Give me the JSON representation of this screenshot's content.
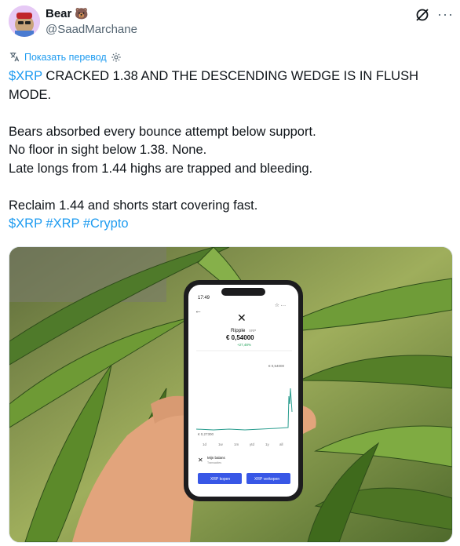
{
  "author": {
    "name": "Bear",
    "emoji": "🐻",
    "handle": "@SaadMarchane"
  },
  "translate": {
    "label": "Показать перевод"
  },
  "tweet": {
    "cashtag1": "$XRP",
    "line1": " CRACKED 1.38 AND THE DESCENDING WEDGE IS IN FLUSH MODE.",
    "body": "Bears absorbed every bounce attempt below support.\nNo floor in sight below 1.38. None.\nLate longs from 1.44 highs are trapped and bleeding.\n\nReclaim 1.44 and shorts start covering fast.",
    "tags": [
      "$XRP",
      "#XRP",
      "#Crypto"
    ]
  },
  "phone": {
    "time": "17:49",
    "coin_name": "Ripple",
    "coin_symbol": "XRP",
    "price": "€ 0,54000",
    "change": "+27,48%",
    "chart_high": "€ 0,54000",
    "chart_low": "€ 0,27300",
    "ranges": [
      "1d",
      "1w",
      "1m",
      "ytd",
      "1y",
      "all"
    ],
    "balance_label": "Mijn balans",
    "balance_sub": "Transacties",
    "buy_label": "XRP kopen",
    "sell_label": "XRP verkopen"
  }
}
